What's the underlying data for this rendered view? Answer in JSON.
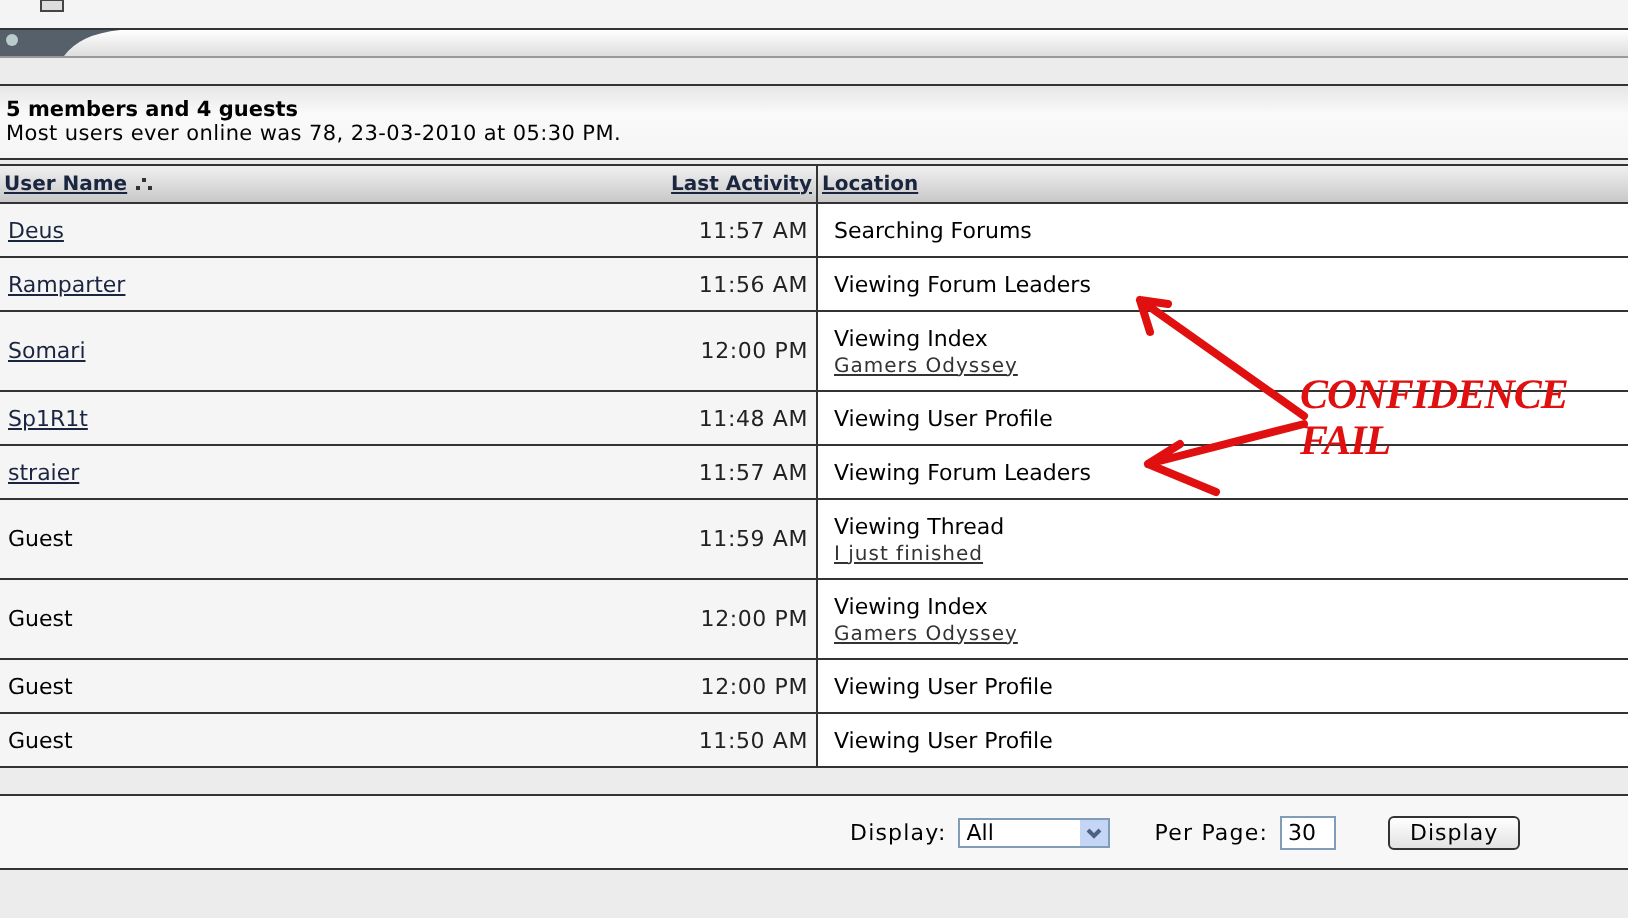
{
  "summary": {
    "counts": "5 members and 4 guests",
    "record": "Most users ever online was 78, 23-03-2010 at 05:30 PM."
  },
  "table": {
    "columns": [
      {
        "label": "User Name",
        "sorted": true
      },
      {
        "label": "Last Activity",
        "sorted": false
      },
      {
        "label": "Location",
        "sorted": false
      }
    ],
    "rows": [
      {
        "user": "Deus",
        "member": true,
        "time": "11:57 AM",
        "location": "Searching Forums"
      },
      {
        "user": "Ramparter",
        "member": true,
        "time": "11:56 AM",
        "location": "Viewing Forum Leaders"
      },
      {
        "user": "Somari",
        "member": true,
        "time": "12:00 PM",
        "location": "Viewing Index",
        "link": "Gamers Odyssey"
      },
      {
        "user": "Sp1R1t",
        "member": true,
        "time": "11:48 AM",
        "location": "Viewing User Profile"
      },
      {
        "user": "straier",
        "member": true,
        "time": "11:57 AM",
        "location": "Viewing Forum Leaders"
      },
      {
        "user": "Guest",
        "member": false,
        "time": "11:59 AM",
        "location": "Viewing Thread",
        "link": "I just finished"
      },
      {
        "user": "Guest",
        "member": false,
        "time": "12:00 PM",
        "location": "Viewing Index",
        "link": "Gamers Odyssey"
      },
      {
        "user": "Guest",
        "member": false,
        "time": "12:00 PM",
        "location": "Viewing User Profile"
      },
      {
        "user": "Guest",
        "member": false,
        "time": "11:50 AM",
        "location": "Viewing User Profile"
      }
    ]
  },
  "footer": {
    "display_label": "Display:",
    "display_value": "All",
    "per_page_label": "Per Page:",
    "per_page_value": "30",
    "button": "Display"
  },
  "annotation": {
    "text_lines": [
      "CONFIDENCE",
      "FAIL"
    ]
  }
}
